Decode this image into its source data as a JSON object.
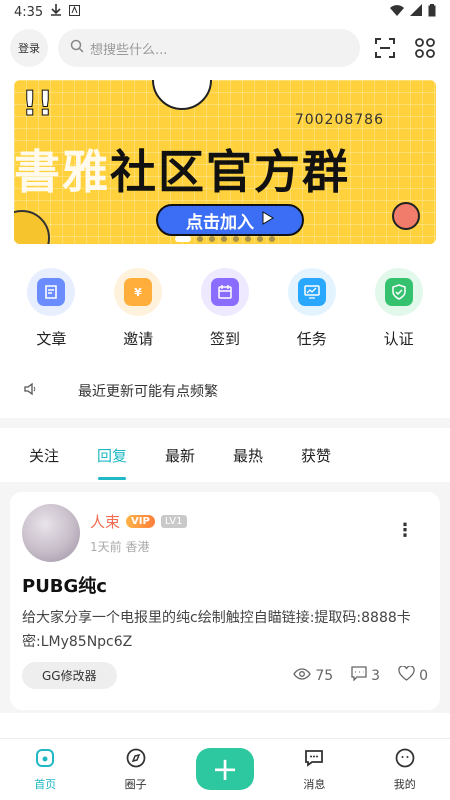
{
  "status": {
    "time": "4:35",
    "icons": [
      "download-icon",
      "a-icon",
      "wifi-icon",
      "signal-icon",
      "battery-icon"
    ]
  },
  "topbar": {
    "login": "登录",
    "search_placeholder": "想搜些什么..."
  },
  "banner": {
    "qq_number": "700208786",
    "title_faded": "書雅",
    "title": "社区官方群",
    "button_label": "点击加入",
    "dot_count": 8
  },
  "quick": [
    {
      "label": "文章",
      "icon": "article-icon",
      "color": "#6b8cff",
      "bg": "#e7eeff"
    },
    {
      "label": "邀请",
      "icon": "money-bag-icon",
      "color": "#ffad3b",
      "bg": "#fff2dd"
    },
    {
      "label": "签到",
      "icon": "calendar-icon",
      "color": "#8a6dff",
      "bg": "#eee9ff"
    },
    {
      "label": "任务",
      "icon": "monitor-icon",
      "color": "#2aa7ff",
      "bg": "#e3f4ff"
    },
    {
      "label": "认证",
      "icon": "shield-check-icon",
      "color": "#35c26f",
      "bg": "#e2f8ea"
    }
  ],
  "notice": {
    "text": "最近更新可能有点频繁"
  },
  "tabs": [
    {
      "label": "关注",
      "active": false
    },
    {
      "label": "回复",
      "active": true
    },
    {
      "label": "最新",
      "active": false
    },
    {
      "label": "最热",
      "active": false
    },
    {
      "label": "获赞",
      "active": false
    }
  ],
  "post": {
    "author": "人束",
    "vip": "VIP",
    "level": "LV1",
    "meta": "1天前 香港",
    "title": "PUBG纯c",
    "body": "给大家分享一个电报里的纯c绘制触控自瞄链接:提取码:8888卡密:LMy85Npc6Z",
    "tag": "GG修改器",
    "views": "75",
    "comments": "3",
    "likes": "0"
  },
  "nav": [
    {
      "label": "首页",
      "icon": "home-icon",
      "active": true
    },
    {
      "label": "圈子",
      "icon": "compass-icon",
      "active": false
    },
    {
      "label": "",
      "icon": "add-icon",
      "active": false
    },
    {
      "label": "消息",
      "icon": "chat-icon",
      "active": false
    },
    {
      "label": "我的",
      "icon": "profile-icon",
      "active": false
    }
  ],
  "colors": {
    "accent": "#1fb8c4",
    "add_button": "#2dc8a0",
    "author": "#f26d4f",
    "banner_bg": "#ffd23d",
    "banner_button": "#3b6ef5"
  }
}
